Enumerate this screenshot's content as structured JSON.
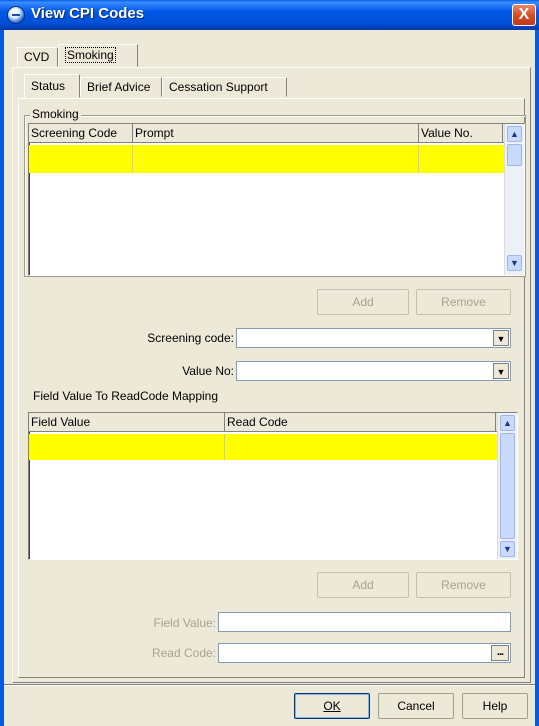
{
  "window": {
    "title": "View CPI Codes",
    "close_label": "X"
  },
  "outer_tabs": [
    {
      "label": "CVD"
    },
    {
      "label": "Smoking"
    }
  ],
  "inner_tabs": [
    {
      "label": "Status"
    },
    {
      "label": "Brief Advice"
    },
    {
      "label": "Cessation Support"
    }
  ],
  "smoking_group": {
    "legend": "Smoking",
    "columns": [
      "Screening Code",
      "Prompt",
      "Value No."
    ],
    "add_label": "Add",
    "remove_label": "Remove"
  },
  "screening_code": {
    "label": "Screening code:",
    "value": ""
  },
  "value_no": {
    "label": "Value No:",
    "value": ""
  },
  "mapping": {
    "title": "Field Value To ReadCode Mapping",
    "columns": [
      "Field Value",
      "Read Code"
    ],
    "add_label": "Add",
    "remove_label": "Remove"
  },
  "field_value": {
    "label": "Field Value:",
    "value": ""
  },
  "read_code": {
    "label": "Read Code:",
    "value": "",
    "button": "..."
  },
  "footer": {
    "ok_label": "OK",
    "cancel_label": "Cancel",
    "help_label": "Help"
  },
  "colors": {
    "selected_row": "#ffff00",
    "title_bar": "#0058e6"
  }
}
